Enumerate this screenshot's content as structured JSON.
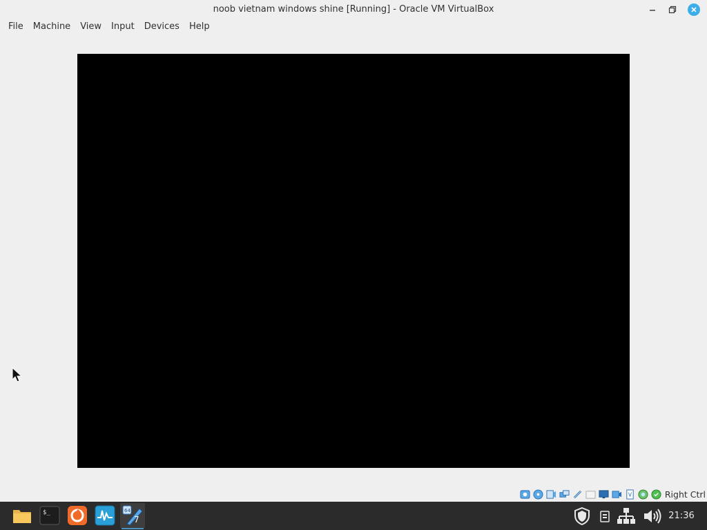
{
  "window": {
    "title": "noob vietnam windows shine [Running] - Oracle VM VirtualBox"
  },
  "menu": {
    "items": [
      "File",
      "Machine",
      "View",
      "Input",
      "Devices",
      "Help"
    ]
  },
  "statusbar": {
    "icons": [
      "hard-disk-icon",
      "optical-drive-icon",
      "audio-icon",
      "network-icon",
      "usb-icon",
      "shared-folders-icon",
      "display-icon",
      "recording-icon",
      "cpu-icon",
      "mouse-integration-icon",
      "keyboard-icon"
    ],
    "host_key": "Right Ctrl"
  },
  "taskbar": {
    "apps": [
      "files-icon",
      "terminal-icon",
      "firefox-icon",
      "system-monitor-icon",
      "virtualbox-icon"
    ],
    "active_app": "virtualbox-icon",
    "clock": "21:36"
  },
  "colors": {
    "window_bg": "#efefef",
    "vm_screen": "#000000",
    "taskbar_bg": "#2b2b2b",
    "accent": "#3daee9"
  }
}
